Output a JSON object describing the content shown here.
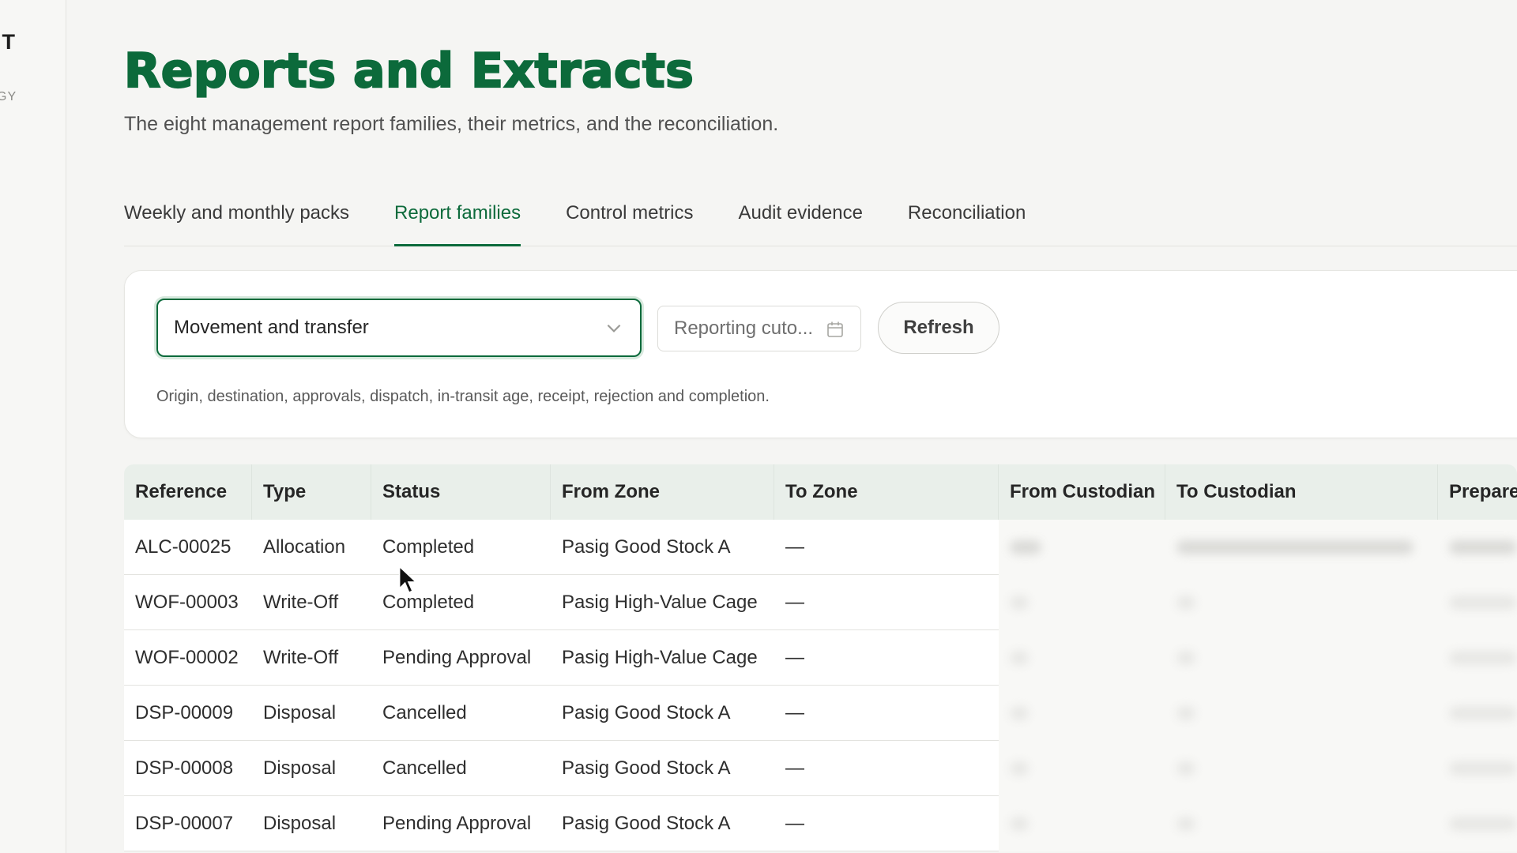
{
  "sidebar": {
    "brand": "IT",
    "brand_sub": "GY"
  },
  "header": {
    "title": "Reports and Extracts",
    "subtitle": "The eight management report families, their metrics, and the reconciliation."
  },
  "tabs": [
    {
      "label": "Weekly and monthly packs",
      "active": false
    },
    {
      "label": "Report families",
      "active": true
    },
    {
      "label": "Control metrics",
      "active": false
    },
    {
      "label": "Audit evidence",
      "active": false
    },
    {
      "label": "Reconciliation",
      "active": false
    }
  ],
  "filters": {
    "family_select": {
      "value": "Movement and transfer",
      "icon": "chevron-down-icon"
    },
    "cutoff_input": {
      "placeholder": "Reporting cuto...",
      "icon": "calendar-icon"
    },
    "refresh_label": "Refresh",
    "description": "Origin, destination, approvals, dispatch, in-transit age, receipt, rejection and completion."
  },
  "table": {
    "columns": [
      "Reference",
      "Type",
      "Status",
      "From Zone",
      "To Zone",
      "From Custodian",
      "To Custodian",
      "Prepare"
    ],
    "rows": [
      [
        "ALC-00025",
        "Allocation",
        "Completed",
        "Pasig Good Stock A",
        "—"
      ],
      [
        "WOF-00003",
        "Write-Off",
        "Completed",
        "Pasig High-Value Cage",
        "—"
      ],
      [
        "WOF-00002",
        "Write-Off",
        "Pending Approval",
        "Pasig High-Value Cage",
        "—"
      ],
      [
        "DSP-00009",
        "Disposal",
        "Cancelled",
        "Pasig Good Stock A",
        "—"
      ],
      [
        "DSP-00008",
        "Disposal",
        "Cancelled",
        "Pasig Good Stock A",
        "—"
      ],
      [
        "DSP-00007",
        "Disposal",
        "Pending Approval",
        "Pasig Good Stock A",
        "—"
      ]
    ]
  },
  "colors": {
    "accent": "#0c6a3b",
    "header_bg": "#e9efea",
    "page_bg": "#f5f5f3"
  }
}
